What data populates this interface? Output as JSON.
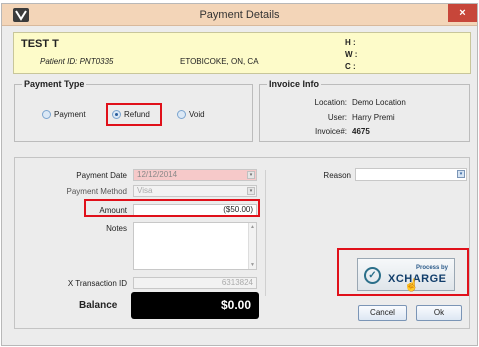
{
  "window": {
    "title": "Payment Details",
    "close_glyph": "×"
  },
  "patient": {
    "name": "TEST T",
    "id_text": "Patient ID: PNT0335",
    "location": "ETOBICOKE, ON, CA",
    "phone_h": "H :",
    "phone_w": "W :",
    "phone_c": "C :"
  },
  "payment_type": {
    "title": "Payment Type",
    "options": [
      "Payment",
      "Refund",
      "Void"
    ],
    "selected": "Refund"
  },
  "invoice": {
    "title": "Invoice Info",
    "location_label": "Location:",
    "location_value": "Demo Location",
    "user_label": "User:",
    "user_value": "Harry Premi",
    "invoice_label": "Invoice#:",
    "invoice_value": "4675"
  },
  "form": {
    "payment_date_label": "Payment Date",
    "payment_date_value": "12/12/2014",
    "payment_method_label": "Payment Method",
    "payment_method_value": "Visa",
    "amount_label": "Amount",
    "amount_value": "($50.00)",
    "notes_label": "Notes",
    "notes_value": "",
    "transaction_label": "X Transaction ID",
    "transaction_value": "6313824",
    "reason_label": "Reason",
    "reason_value": "",
    "balance_label": "Balance",
    "balance_value": "$0.00"
  },
  "xcharge": {
    "process_by": "Process by",
    "brand": "XCHARGE",
    "icon": "check-circle-icon"
  },
  "buttons": {
    "cancel": "Cancel",
    "ok": "Ok"
  },
  "colors": {
    "highlight": "#e0101a",
    "titlebar": "#f3d5b8",
    "patient_bg": "#fdfbc9",
    "close": "#c7463a"
  }
}
